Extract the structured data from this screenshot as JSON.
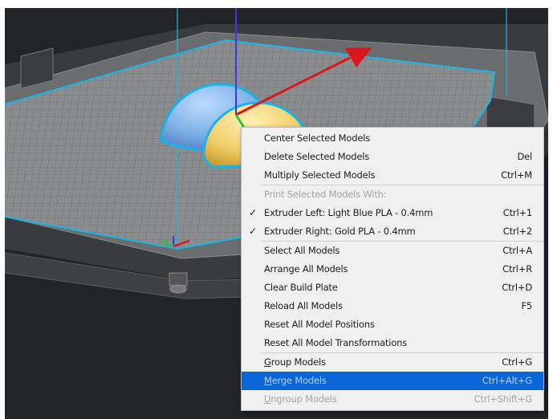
{
  "menu": {
    "items": [
      {
        "label": "Center Selected Models",
        "shortcut": ""
      },
      {
        "label": "Delete Selected Models",
        "shortcut": "Del"
      },
      {
        "label": "Multiply Selected Models",
        "shortcut": "Ctrl+M"
      },
      {
        "label": "Print Selected Models With:",
        "shortcut": ""
      },
      {
        "label": "Extruder Left: Light Blue PLA - 0.4mm",
        "shortcut": "Ctrl+1",
        "checked": true
      },
      {
        "label": "Extruder Right: Gold PLA - 0.4mm",
        "shortcut": "Ctrl+2",
        "checked": true
      },
      {
        "label": "Select All Models",
        "shortcut": "Ctrl+A"
      },
      {
        "label": "Arrange All Models",
        "shortcut": "Ctrl+R"
      },
      {
        "label": "Clear Build Plate",
        "shortcut": "Ctrl+D"
      },
      {
        "label": "Reload All Models",
        "shortcut": "F5"
      },
      {
        "label": "Reset All Model Positions",
        "shortcut": ""
      },
      {
        "label": "Reset All Model Transformations",
        "shortcut": ""
      },
      {
        "label_mnemonic": "G",
        "label_rest": "roup Models",
        "shortcut": "Ctrl+G"
      },
      {
        "label_mnemonic": "M",
        "label_rest": "erge Models",
        "shortcut": "Ctrl+Alt+G",
        "highlighted": true
      },
      {
        "label_mnemonic": "U",
        "label_rest": "ngroup Models",
        "shortcut": "Ctrl+Shift+G",
        "disabled": true
      }
    ],
    "check_glyph": "✓"
  },
  "scene": {
    "objects": [
      {
        "name": "model-left",
        "color": "#7fb0e6",
        "outline": "#18b4e8"
      },
      {
        "name": "model-right",
        "color": "#f2cf6a",
        "outline": "#18b4e8"
      }
    ],
    "axes": {
      "x_color": "#d8161c",
      "y_color": "#22c83a",
      "z_color": "#3a3ae0"
    }
  }
}
